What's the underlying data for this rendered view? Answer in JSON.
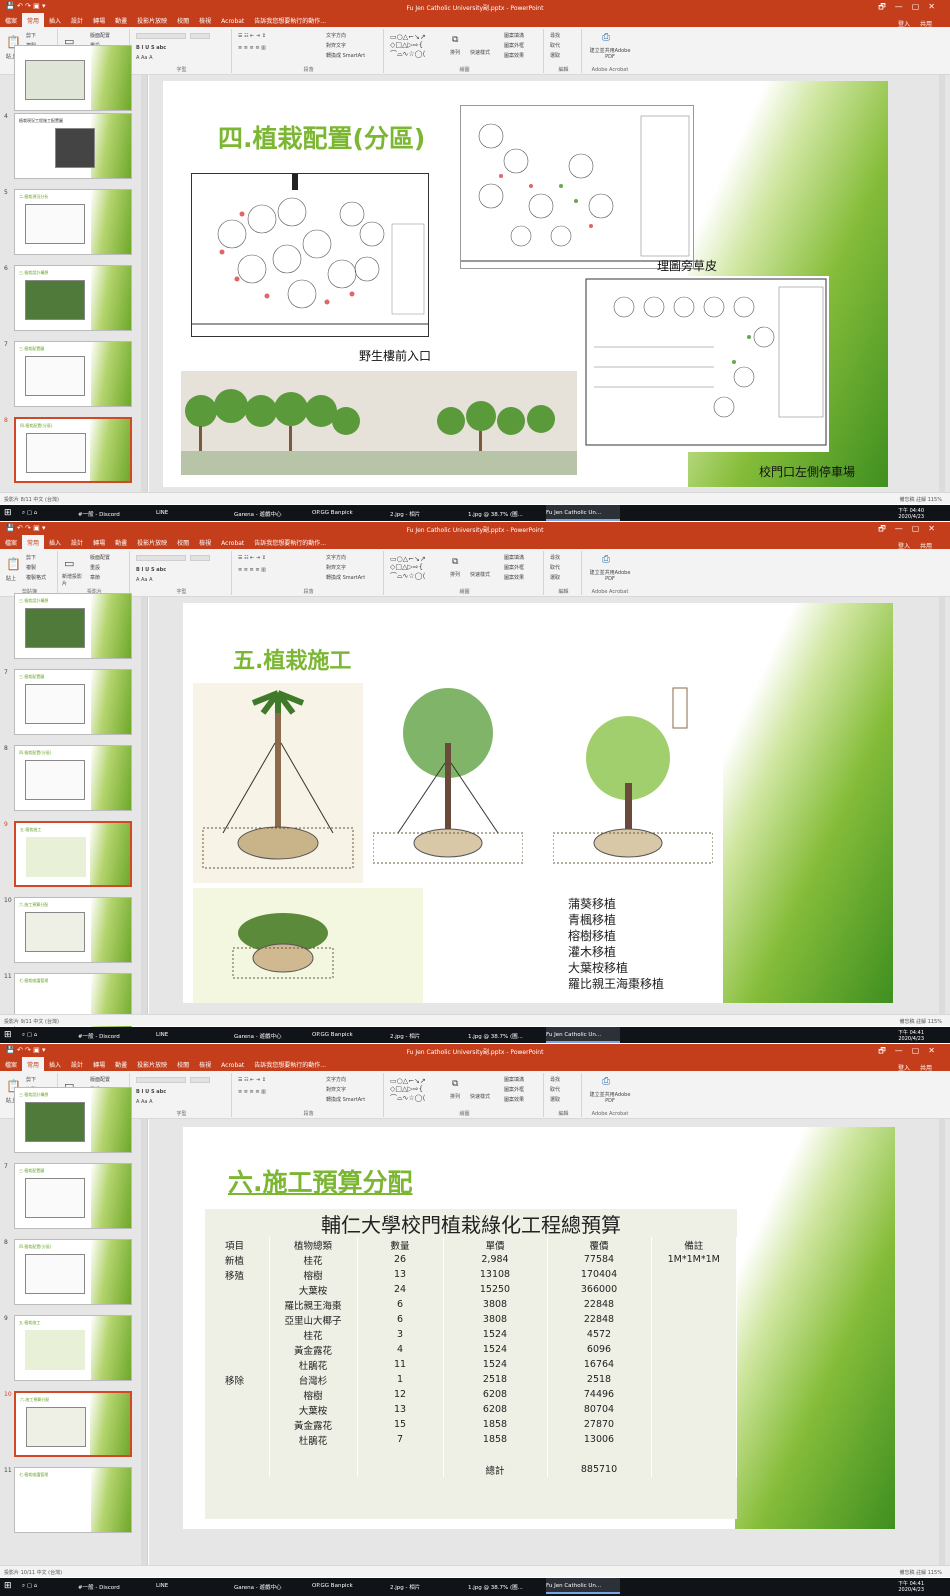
{
  "window": {
    "title": "Fu Jen Catholic University副.pptx - PowerPoint",
    "controls": [
      "🗗",
      "—",
      "▢",
      "✕"
    ]
  },
  "tabs": [
    "檔案",
    "常用",
    "插入",
    "設計",
    "轉場",
    "動畫",
    "投影片放映",
    "校閱",
    "檢視",
    "Acrobat",
    "告訴我您想要執行的動作..."
  ],
  "tabs_right": [
    "登入",
    "共用"
  ],
  "ribbon": {
    "paste": "貼上",
    "cut": "剪下",
    "copy": "複製",
    "format_painter": "複製格式",
    "clipboard": "剪貼簿",
    "new_slide": "新增投影片",
    "layout": "版面配置",
    "reset": "重設",
    "section": "章節",
    "slides": "投影片",
    "font": "字型",
    "paragraph": "段落",
    "text_direction": "文字方向",
    "align_text": "對齊文字",
    "smartart": "轉換成 SmartArt",
    "drawing": "繪圖",
    "arrange": "排列",
    "quick_styles": "快速樣式",
    "shape_fill": "圖案填滿",
    "shape_outline": "圖案外框",
    "shape_effects": "圖案效果",
    "find": "尋找",
    "replace": "取代",
    "select": "選取",
    "editing": "編輯",
    "adobe_create": "建立並共用Adobe PDF",
    "adobe_acrobat": "Adobe Acrobat"
  },
  "panels": [
    {
      "thumbs": [
        {
          "num": "",
          "title": ""
        },
        {
          "num": "4",
          "title": "植栽現況工程施工配置圖"
        },
        {
          "num": "5",
          "title": "二.植栽現況分析"
        },
        {
          "num": "6",
          "title": "三.植栽設計構想"
        },
        {
          "num": "7",
          "title": "三.植栽配置圖"
        },
        {
          "num": "8",
          "title": "四.植栽配置(分區)"
        }
      ],
      "slide": {
        "title": "四.植栽配置(分區)",
        "captions": {
          "entrance": "野生樓前入口",
          "lawn": "理圖旁草皮",
          "parking": "校門口左側停車場"
        }
      },
      "status": {
        "left": "投影片 8/11    中文 (台灣)",
        "right": "備忘稿    註解    115%"
      },
      "clock": {
        "time": "下午 04:40",
        "date": "2020/4/23"
      }
    },
    {
      "thumbs": [
        {
          "num": "",
          "title": "三.植栽設計構想"
        },
        {
          "num": "7",
          "title": "三.植栽配置圖"
        },
        {
          "num": "8",
          "title": "四.植栽配置(分區)"
        },
        {
          "num": "9",
          "title": "五.植栽施工"
        },
        {
          "num": "10",
          "title": "六.施工預算分配"
        },
        {
          "num": "11",
          "title": "七.植栽維護管理"
        }
      ],
      "slide": {
        "title": "五.植栽施工",
        "plants": [
          "蒲葵移植",
          "青楓移植",
          "榕樹移植",
          "灌木移植",
          "大葉桉移植",
          "羅比親王海棗移植"
        ]
      },
      "status": {
        "left": "投影片 9/11    中文 (台灣)",
        "right": "備忘稿    註解    115%"
      },
      "clock": {
        "time": "下午 04:41",
        "date": "2020/4/23"
      }
    },
    {
      "thumbs": [
        {
          "num": "",
          "title": "三.植栽設計構想"
        },
        {
          "num": "7",
          "title": "三.植栽配置圖"
        },
        {
          "num": "8",
          "title": "四.植栽配置(分區)"
        },
        {
          "num": "9",
          "title": "五.植栽施工"
        },
        {
          "num": "10",
          "title": "六.施工預算分配"
        },
        {
          "num": "11",
          "title": "七.植栽維護管理"
        }
      ],
      "slide": {
        "title": "六.施工預算分配",
        "table_title": "輔仁大學校門植栽綠化工程總預算",
        "headers": [
          "項目",
          "植物總類",
          "數量",
          "單價",
          "覆價",
          "備註"
        ],
        "rows": [
          [
            "新植",
            "桂花",
            "26",
            "2,984",
            "77584",
            "1M*1M*1M"
          ],
          [
            "移殖",
            "榕樹",
            "13",
            "13108",
            "170404",
            ""
          ],
          [
            "",
            "大葉桉",
            "24",
            "15250",
            "366000",
            ""
          ],
          [
            "",
            "羅比親王海棗",
            "6",
            "3808",
            "22848",
            ""
          ],
          [
            "",
            "亞里山大椰子",
            "6",
            "3808",
            "22848",
            ""
          ],
          [
            "",
            "桂花",
            "3",
            "1524",
            "4572",
            ""
          ],
          [
            "",
            "黃金露花",
            "4",
            "1524",
            "6096",
            ""
          ],
          [
            "",
            "杜鵑花",
            "11",
            "1524",
            "16764",
            ""
          ],
          [
            "移除",
            "台灣杉",
            "1",
            "2518",
            "2518",
            ""
          ],
          [
            "",
            "榕樹",
            "12",
            "6208",
            "74496",
            ""
          ],
          [
            "",
            "大葉桉",
            "13",
            "6208",
            "80704",
            ""
          ],
          [
            "",
            "黃金露花",
            "15",
            "1858",
            "27870",
            ""
          ],
          [
            "",
            "杜鵑花",
            "7",
            "1858",
            "13006",
            ""
          ],
          [
            "",
            "",
            "",
            "",
            "",
            ""
          ],
          [
            "",
            "",
            "",
            "總計",
            "885710",
            ""
          ]
        ]
      },
      "status": {
        "left": "投影片 10/11    中文 (台灣)",
        "right": "備忘稿    註解    115%"
      },
      "clock": {
        "time": "下午 04:41",
        "date": "2020/4/23"
      }
    }
  ],
  "taskbar_items": [
    "#一般 - Discord",
    "LINE",
    "Garena - 遊戲中心",
    "OP.GG Banpick",
    "2.jpg - 相片",
    "1.jpg @ 38.7% (圖...",
    "Fu Jen Catholic Un..."
  ],
  "colors": {
    "accent": "#c43e1c",
    "green": "#7cb733",
    "selection": "#d24726"
  }
}
